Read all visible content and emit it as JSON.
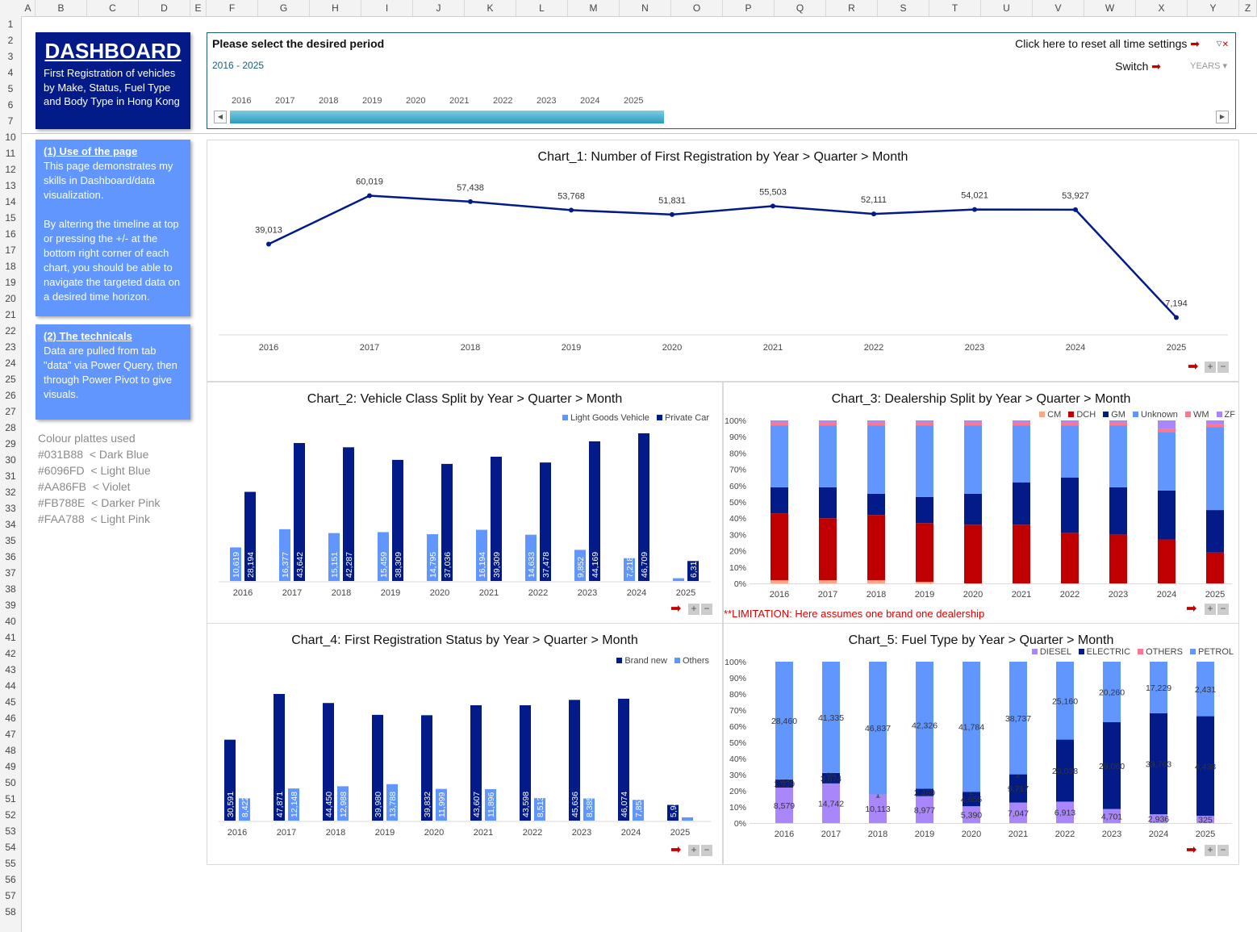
{
  "spreadsheet": {
    "columns": [
      "A",
      "B",
      "C",
      "D",
      "E",
      "F",
      "G",
      "H",
      "I",
      "J",
      "K",
      "L",
      "M",
      "N",
      "O",
      "P",
      "Q",
      "R",
      "S",
      "T",
      "U",
      "V",
      "W",
      "X",
      "Y",
      "Z"
    ],
    "rows": [
      "1",
      "2",
      "3",
      "4",
      "5",
      "6",
      "7",
      "10",
      "11",
      "12",
      "13",
      "14",
      "15",
      "16",
      "17",
      "18",
      "19",
      "20",
      "21",
      "22",
      "23",
      "24",
      "25",
      "26",
      "27",
      "28",
      "29",
      "30",
      "31",
      "32",
      "33",
      "34",
      "35",
      "36",
      "37",
      "38",
      "39",
      "40",
      "41",
      "42",
      "43",
      "44",
      "45",
      "46",
      "47",
      "48",
      "49",
      "50",
      "51",
      "52",
      "53",
      "54",
      "55",
      "56",
      "57",
      "58"
    ]
  },
  "dashboard": {
    "title": "DASHBOARD",
    "subtitle": "First Registration of vehicles by Make, Status, Fuel Type and Body Type in Hong Kong"
  },
  "use_of_page": {
    "heading": "(1) Use of the page",
    "body": "This page demonstrates my skills in Dashboard/data visualization.\n\nBy altering the timeline at top or pressing the +/- at the bottom right corner of each chart, you should be able to navigate the targeted data on a desired time horizon."
  },
  "technicals": {
    "heading": "(2) The technicals",
    "body": "Data are pulled from tab \"data\" via Power Query, then through Power Pivot to give visuals."
  },
  "palette": {
    "heading": "Colour plattes used",
    "items": [
      {
        "hex": "#031B88",
        "label": "< Dark Blue"
      },
      {
        "hex": "#6096FD",
        "label": "< Light Blue"
      },
      {
        "hex": "#AA86FB",
        "label": "< Violet"
      },
      {
        "hex": "#FB788E",
        "label": "< Darker Pink"
      },
      {
        "hex": "#FAA788",
        "label": "< Light Pink"
      }
    ]
  },
  "timeline": {
    "title": "Please select the desired period",
    "range": "2016 - 2025",
    "reset_label": "Click here to reset all time settings",
    "switch_label": "Switch",
    "unit_label": "YEARS",
    "years": [
      "2016",
      "2017",
      "2018",
      "2019",
      "2020",
      "2021",
      "2022",
      "2023",
      "2024",
      "2025"
    ]
  },
  "colors": {
    "dark_blue": "#031B88",
    "light_blue": "#6096FD",
    "violet": "#AA86FB",
    "darker_pink": "#FB788E",
    "light_pink": "#FAA788",
    "red": "#C00000",
    "arrow": "#C00000"
  },
  "limitation": "**LIMITATION: Here assumes one brand one dealership",
  "chart_data": [
    {
      "id": "chart1",
      "type": "line",
      "title": "Chart_1: Number of First Registration by Year > Quarter > Month",
      "categories": [
        "2016",
        "2017",
        "2018",
        "2019",
        "2020",
        "2021",
        "2022",
        "2023",
        "2024",
        "2025"
      ],
      "values": [
        39013,
        60019,
        57438,
        53768,
        51831,
        55503,
        52111,
        54021,
        53927,
        7194
      ],
      "labels": [
        "39,013",
        "60,019",
        "57,438",
        "53,768",
        "51,831",
        "55,503",
        "52,111",
        "54,021",
        "53,927",
        "7,194"
      ],
      "ylim": [
        0,
        70000
      ]
    },
    {
      "id": "chart2",
      "type": "bar",
      "title": "Chart_2: Vehicle Class Split by Year > Quarter > Month",
      "categories": [
        "2016",
        "2017",
        "2018",
        "2019",
        "2020",
        "2021",
        "2022",
        "2023",
        "2024",
        "2025"
      ],
      "series": [
        {
          "name": "Light Goods Vehicle",
          "color": "#6096FD",
          "values": [
            10619,
            16377,
            15151,
            15459,
            14795,
            16194,
            14633,
            9852,
            7218,
            876
          ],
          "labels": [
            "10,619",
            "16,377",
            "15,151",
            "15,459",
            "14,795",
            "16,194",
            "14,633",
            "9,852",
            "7,218",
            "876"
          ]
        },
        {
          "name": "Private Car",
          "color": "#031B88",
          "values": [
            28194,
            43642,
            42287,
            38309,
            37036,
            39309,
            37478,
            44169,
            46709,
            6318
          ],
          "labels": [
            "28,194",
            "43,642",
            "42,287",
            "38,309",
            "37,036",
            "39,309",
            "37,478",
            "44,169",
            "46,709",
            "6,318"
          ]
        }
      ],
      "ylim": [
        0,
        50000
      ]
    },
    {
      "id": "chart3",
      "type": "bar",
      "stacked": "percent",
      "title": "Chart_3: Dealership Split by Year > Quarter > Month",
      "categories": [
        "2016",
        "2017",
        "2018",
        "2019",
        "2020",
        "2021",
        "2022",
        "2023",
        "2024",
        "2025"
      ],
      "yticks": [
        "0%",
        "10%",
        "20%",
        "30%",
        "40%",
        "50%",
        "60%",
        "70%",
        "80%",
        "90%",
        "100%"
      ],
      "series": [
        {
          "name": "CM",
          "color": "#FAA788",
          "values": [
            2,
            2,
            2,
            1,
            0,
            0,
            0,
            0,
            0,
            0
          ]
        },
        {
          "name": "DCH",
          "color": "#C00000",
          "values": [
            41,
            38,
            40,
            36,
            36,
            36,
            31,
            30,
            27,
            19
          ]
        },
        {
          "name": "GM",
          "color": "#031B88",
          "values": [
            16,
            19,
            13,
            16,
            19,
            26,
            34,
            29,
            30,
            26
          ]
        },
        {
          "name": "Unknown",
          "color": "#6096FD",
          "values": [
            38,
            38,
            42,
            44,
            42,
            35,
            32,
            38,
            36,
            51
          ]
        },
        {
          "name": "WM",
          "color": "#FB788E",
          "values": [
            2,
            2,
            2,
            2,
            2,
            2,
            2,
            2,
            2,
            2
          ]
        },
        {
          "name": "ZF",
          "color": "#AA86FB",
          "values": [
            1,
            1,
            1,
            1,
            1,
            1,
            1,
            1,
            5,
            2
          ]
        }
      ]
    },
    {
      "id": "chart4",
      "type": "bar",
      "title": "Chart_4: First Registration Status by Year > Quarter > Month",
      "categories": [
        "2016",
        "2017",
        "2018",
        "2019",
        "2020",
        "2021",
        "2022",
        "2023",
        "2024",
        "2025"
      ],
      "series": [
        {
          "name": "Brand new",
          "color": "#031B88",
          "values": [
            30591,
            47871,
            44450,
            39980,
            39832,
            43607,
            43598,
            45636,
            46074,
            5944
          ],
          "labels": [
            "30,591",
            "47,871",
            "44,450",
            "39,980",
            "39,832",
            "43,607",
            "43,598",
            "45,636",
            "46,074",
            "5,944"
          ]
        },
        {
          "name": "Others",
          "color": "#6096FD",
          "values": [
            8422,
            12148,
            12988,
            13788,
            11999,
            11896,
            8513,
            8385,
            7853,
            1250
          ],
          "labels": [
            "8,422",
            "12,148",
            "12,988",
            "13,788",
            "11,999",
            "11,896",
            "8,513",
            "8,385",
            "7,853",
            "1,250"
          ]
        }
      ],
      "ylim": [
        0,
        60000
      ]
    },
    {
      "id": "chart5",
      "type": "bar",
      "stacked": "percent",
      "title": "Chart_5: Fuel Type by Year > Quarter > Month",
      "categories": [
        "2016",
        "2017",
        "2018",
        "2019",
        "2020",
        "2021",
        "2022",
        "2023",
        "2024",
        "2025"
      ],
      "yticks": [
        "0%",
        "10%",
        "20%",
        "30%",
        "40%",
        "50%",
        "60%",
        "70%",
        "80%",
        "90%",
        "100%"
      ],
      "series": [
        {
          "name": "DIESEL",
          "color": "#AA86FB",
          "values": [
            8579,
            14742,
            10113,
            8977,
            5390,
            7047,
            6913,
            4701,
            2936,
            325
          ],
          "labels": [
            "8,579",
            "14,742",
            "10,113",
            "8,977",
            "5,390",
            "7,047",
            "6,913",
            "4,701",
            "2,936",
            "325"
          ]
        },
        {
          "name": "ELECTRIC",
          "color": "#031B88",
          "values": [
            1939,
            3874,
            1,
            2469,
            4655,
            9717,
            20038,
            29060,
            33763,
            4438
          ],
          "labels": [
            "1,939",
            "3,874",
            "1",
            "2,469",
            "4,655",
            "9,717",
            "20,038",
            "29,060",
            "33,763",
            "4,438"
          ]
        },
        {
          "name": "OTHERS",
          "color": "#FB788E",
          "values": [
            35,
            68,
            1,
            1,
            2,
            2,
            0,
            0,
            0,
            0
          ],
          "labels": [
            "35",
            "68",
            "1",
            "",
            "2",
            "2",
            "",
            "",
            "",
            ""
          ]
        },
        {
          "name": "PETROL",
          "color": "#6096FD",
          "values": [
            28460,
            41335,
            46837,
            42326,
            41784,
            38737,
            25160,
            20260,
            17229,
            2431
          ],
          "labels": [
            "28,460",
            "41,335",
            "46,837",
            "42,326",
            "41,784",
            "38,737",
            "25,160",
            "20,260",
            "17,229",
            "2,431"
          ]
        }
      ]
    }
  ]
}
